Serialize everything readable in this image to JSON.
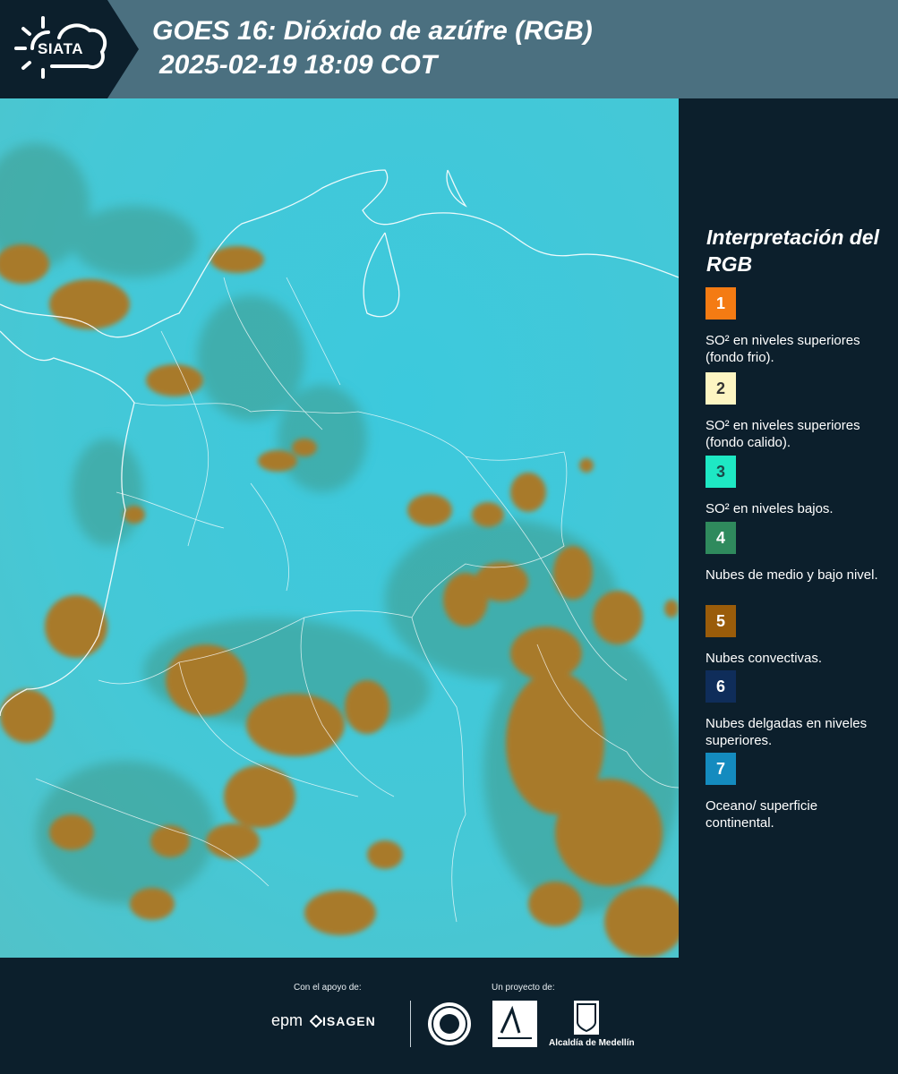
{
  "header": {
    "logo_text": "SIATA",
    "title_line1": "GOES 16: Dióxido de azúfre (RGB)",
    "title_line2": "2025-02-19 18:09 COT"
  },
  "legend": {
    "title": "Interpretación del RGB",
    "items": [
      {
        "number": "1",
        "color": "#f47b13",
        "text_color": "#ffffff",
        "text": "SO² en niveles superiores (fondo frio)."
      },
      {
        "number": "2",
        "color": "#fdf5c2",
        "text_color": "#333333",
        "text": "SO² en niveles superiores (fondo calido)."
      },
      {
        "number": "3",
        "color": "#1ee8c4",
        "text_color": "#1a4a4a",
        "text": "SO² en niveles bajos."
      },
      {
        "number": "4",
        "color": "#2f8a5d",
        "text_color": "#ffffff",
        "text": "Nubes de medio y bajo nivel."
      },
      {
        "number": "5",
        "color": "#9a5c0a",
        "text_color": "#ffffff",
        "text": "Nubes convectivas."
      },
      {
        "number": "6",
        "color": "#0f2d5a",
        "text_color": "#ffffff",
        "text": "Nubes delgadas en niveles superiores."
      },
      {
        "number": "7",
        "color": "#148bbf",
        "text_color": "#ffffff",
        "text": "Oceano/ superficie continental."
      }
    ]
  },
  "footer": {
    "support_label": "Con el apoyo de:",
    "project_label": "Un proyecto de:",
    "epm": "epm",
    "isagen": "ISAGEN",
    "alcaldia": "Alcaldía de Medellín"
  },
  "colors": {
    "background": "#0c1f2c",
    "header": "#4b7080",
    "map_sky": "#3fc7d9",
    "cloud_orange": "#a87a2a",
    "cloud_green": "#3f9a8a"
  }
}
